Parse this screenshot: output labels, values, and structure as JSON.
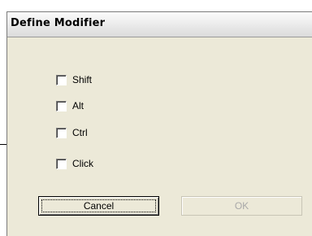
{
  "dialog": {
    "title": "Define Modifier"
  },
  "options": [
    {
      "label": "Shift",
      "checked": false
    },
    {
      "label": "Alt",
      "checked": false
    },
    {
      "label": "Ctrl",
      "checked": false
    },
    {
      "label": "Click",
      "checked": false
    }
  ],
  "buttons": {
    "cancel_label": "Cancel",
    "ok_label": "OK",
    "ok_enabled": false
  }
}
